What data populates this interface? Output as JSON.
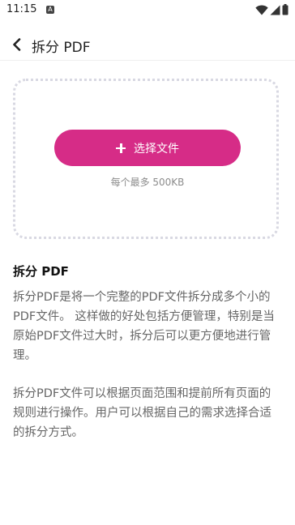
{
  "status_bar": {
    "time": "11:15",
    "notification_badge": "A"
  },
  "app_bar": {
    "title": "拆分 PDF"
  },
  "upload": {
    "button_label": "选择文件",
    "size_hint": "每个最多 500KB"
  },
  "description": {
    "title": "拆分 PDF",
    "paragraph_1": "拆分PDF是将一个完整的PDF文件拆分成多个小的PDF文件。 这样做的好处包括方便管理，特别是当原始PDF文件过大时，拆分后可以更方便地进行管理。",
    "paragraph_2": "拆分PDF文件可以根据页面范围和提前所有页面的规则进行操作。用户可以根据自己的需求选择合适的拆分方式。"
  },
  "colors": {
    "accent": "#d62c87",
    "dotted_border": "#d8d8e2",
    "body_text": "#666666"
  },
  "icons": [
    "wifi-icon",
    "signal-icon",
    "battery-icon",
    "back-arrow-icon",
    "plus-icon"
  ]
}
